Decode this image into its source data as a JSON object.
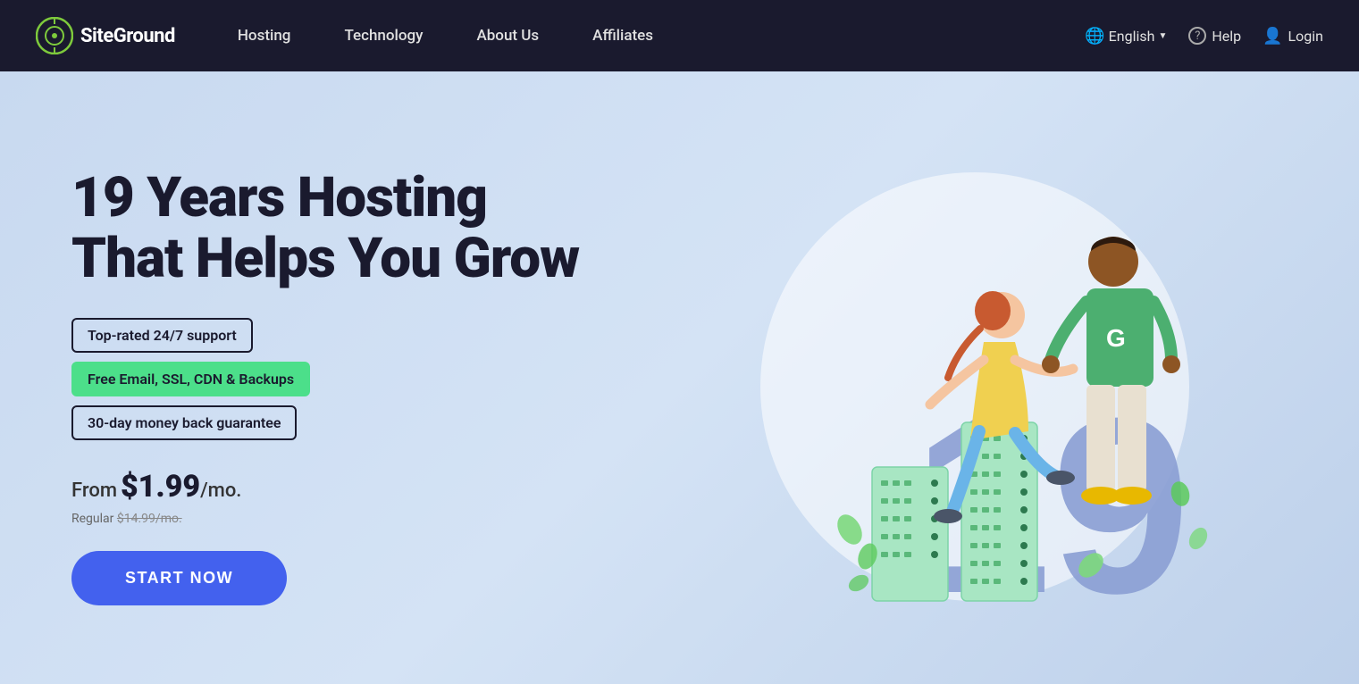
{
  "nav": {
    "logo_text": "SiteGround",
    "links": [
      {
        "label": "Hosting",
        "id": "hosting"
      },
      {
        "label": "Technology",
        "id": "technology"
      },
      {
        "label": "About Us",
        "id": "about-us"
      },
      {
        "label": "Affiliates",
        "id": "affiliates"
      }
    ],
    "right": {
      "language": "English",
      "language_icon": "🌐",
      "help": "Help",
      "help_icon": "?",
      "login": "Login",
      "login_icon": "👤"
    }
  },
  "hero": {
    "title_line1": "19 Years Hosting",
    "title_line2": "That Helps You Grow",
    "badge1": "Top-rated 24/7 support",
    "badge2": "Free Email, SSL, CDN & Backups",
    "badge3": "30-day money back guarantee",
    "price_from": "From",
    "price_amount": "$1.99",
    "price_period": "/mo.",
    "price_regular_label": "Regular",
    "price_regular_amount": "$14.99/mo.",
    "cta_label": "START NOW"
  },
  "colors": {
    "background": "#c8d9f0",
    "nav_bg": "#1a1a2e",
    "cta_bg": "#4361ee",
    "badge_green": "#4cdf8a",
    "dark_text": "#1a1a2e",
    "server_color": "#a8e6c3",
    "number_color": "#7b8fcc"
  }
}
